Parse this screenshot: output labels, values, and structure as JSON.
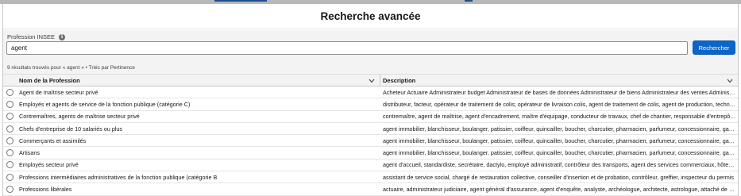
{
  "modal": {
    "title": "Recherche avancée"
  },
  "search": {
    "label": "Profession INSEE",
    "info_icon": "info-icon",
    "value": "agent",
    "button_label": "Rechercher"
  },
  "results": {
    "summary": "9 résultats trouvés pour « agent » • Triés par Pertinence"
  },
  "table": {
    "columns": [
      "Nom de la Profession",
      "Description"
    ],
    "rows": [
      {
        "name": "Agent de maîtrise secteur privé",
        "description": "Acheteur Actuaire Administrateur budget Administrateur de bases de données Administrateur de biens Administrateur des ventes Administrateur"
      },
      {
        "name": "Employés et agents de service de la fonction publique (catégorie C)",
        "description": "distributeur, facteur, opérateur de traitement de colis; opérateur de livraison colis, agent de traitement de colis, agent de production, technicien"
      },
      {
        "name": "Contremaîtres, agents de maîtrise secteur privé",
        "description": "contremaître, agent de maîtrise, agent d'encadrement, maître d'équipage, conducteur de travaux, chef de chantier, responsable d'entrepôt en"
      },
      {
        "name": "Chefs d'entreprise de 10 salariés ou plus",
        "description": "agent immobilier, blanchisseur, boulanger, patissier, coiffeur, quincailler, boucher, charcutier, pharmacien, parfumeur, concessionnaire, garagiste"
      },
      {
        "name": "Commerçants et assimilés",
        "description": "agent immobilier, blanchisseur, boulanger, patissier, coiffeur, quincailler, boucher, charcutier, pharmacien, parfumeur, concessionnaire, garagiste"
      },
      {
        "name": "Artisans",
        "description": "agent immobilier, blanchisseur, boulanger, patissier, coiffeur, quincailler, boucher, charcutier, pharmacien, parfumeur, concessionnaire, garagiste"
      },
      {
        "name": "Employés secteur privé",
        "description": "agent d'accueil, standardiste, secrétaire, dactylo, employé administratif, contrôleur des transports, agent des services commerciaux, hôtesse"
      },
      {
        "name": "Professions intermédiaires administratives de la fonction publique (catégorie B",
        "description": "assistant de service social, chargé de restauration collective, conseiller d'insertion et de probation, contrôleur, greffier, inspecteur du permis"
      },
      {
        "name": "Professions libérales",
        "description": "actuaire, administrateur judiciaire, agent général d'assurance, agent d'enquête, analyste, archéologue, architecte, astrologue, attaché de presse"
      }
    ]
  }
}
